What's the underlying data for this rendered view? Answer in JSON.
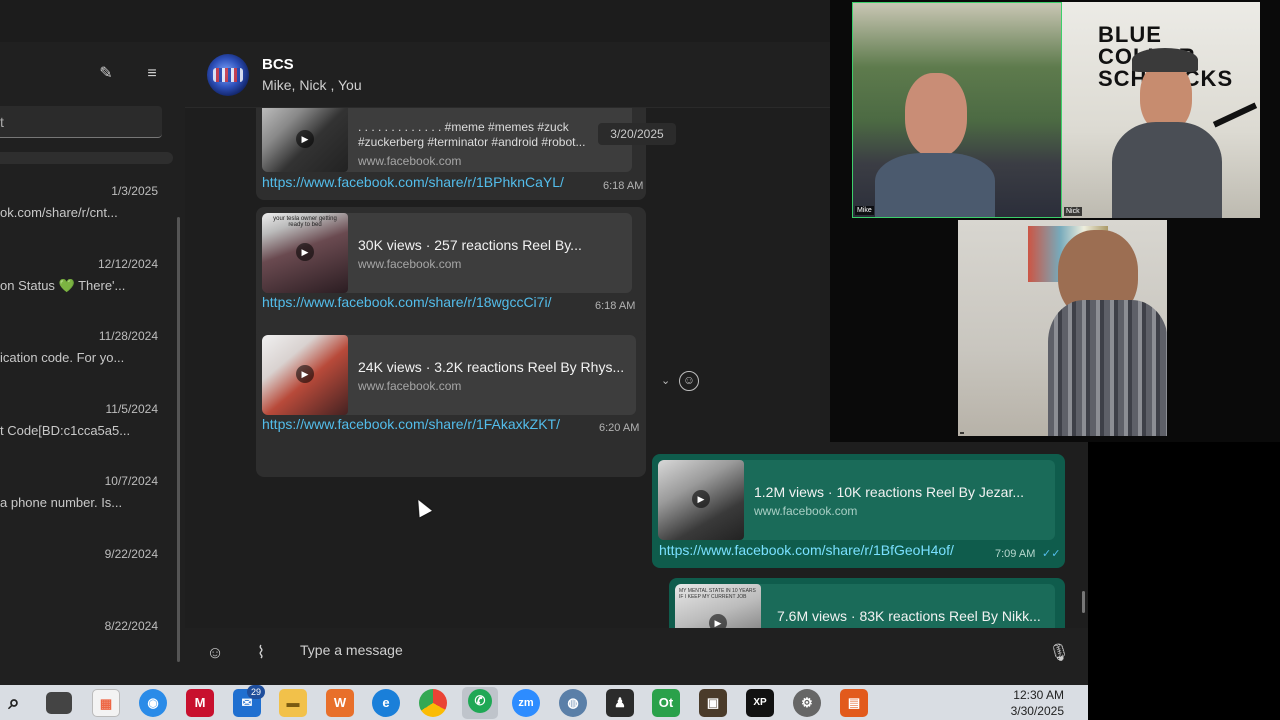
{
  "sidebar": {
    "search_text": "t",
    "chats": [
      {
        "date": "1/3/2025",
        "preview": "ok.com/share/r/cnt..."
      },
      {
        "date": "12/12/2024",
        "preview": "on Status 💚 There'..."
      },
      {
        "date": "11/28/2024",
        "preview": "ication code. For yo..."
      },
      {
        "date": "11/5/2024",
        "preview": "t Code[BD:c1cca5a5..."
      },
      {
        "date": "10/7/2024",
        "preview": "a phone number. Is..."
      },
      {
        "date": "9/22/2024",
        "preview": ""
      },
      {
        "date": "8/22/2024",
        "preview": ""
      }
    ],
    "new_chat_icon": "compose-icon",
    "filter_icon": "filter-icon"
  },
  "chat": {
    "group_name": "BCS",
    "members": "Mike, Nick , You",
    "date_chip": "3/20/2025",
    "messages": [
      {
        "snippet_line1": ". . . . . . . . . . . . . #meme #memes #zuck",
        "snippet_line2": "#zuckerberg #terminator #android #robot...",
        "site": "www.facebook.com",
        "link": "https://www.facebook.com/share/r/1BPhknCaYL/",
        "time": "6:18 AM"
      },
      {
        "title": "30K views · 257 reactions Reel By...",
        "thumb_text": "your tesla owner getting ready to bed",
        "site": "www.facebook.com",
        "link": "https://www.facebook.com/share/r/18wgccCi7i/",
        "time": "6:18 AM"
      },
      {
        "title": "24K views · 3.2K reactions Reel By Rhys...",
        "site": "www.facebook.com",
        "link": "https://www.facebook.com/share/r/1FAkaxkZKT/",
        "time": "6:20 AM"
      },
      {
        "title": "1.2M views · 10K reactions Reel By Jezar...",
        "site": "www.facebook.com",
        "link": "https://www.facebook.com/share/r/1BfGeoH4of/",
        "time": "7:09 AM"
      },
      {
        "title": "7.6M views · 83K reactions Reel By Nikk...",
        "thumb_text": "MY MENTAL STATE IN 10 YEARS IF I KEEP MY CURRENT JOB"
      }
    ],
    "input_placeholder": "Type a message"
  },
  "video_call": {
    "tiles": [
      {
        "label": "Mike"
      },
      {
        "label": "Nick"
      },
      {
        "label": ""
      }
    ],
    "banner_text": "BLUE COLLAR SCHMUCKS"
  },
  "taskbar": {
    "time": "12:30 AM",
    "date": "3/30/2025",
    "mail_badge": "29",
    "icons": [
      "search-icon",
      "task-view-icon",
      "store-icon",
      "firefox-icon",
      "mcafee-icon",
      "mail-icon",
      "file-explorer-icon",
      "wps-icon",
      "edge-icon",
      "chrome-icon",
      "whatsapp-icon",
      "zoom-icon",
      "app-icon",
      "app-icon",
      "ot-icon",
      "app-icon",
      "xp-pen-icon",
      "settings-icon",
      "app-icon"
    ]
  },
  "colors": {
    "link": "#53bdeb",
    "outgoing_bubble": "#0f5c4c",
    "incoming_bubble": "#2e2e2e",
    "background": "#1e1e1e"
  }
}
